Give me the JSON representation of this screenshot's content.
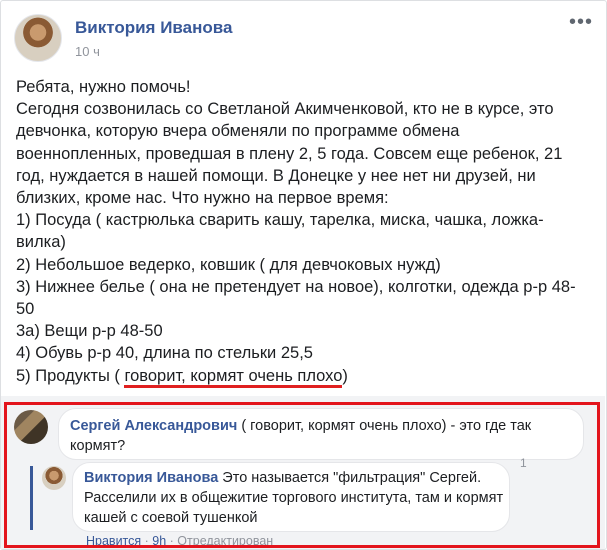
{
  "post": {
    "author": "Виктория Иванова",
    "time": "10 ч",
    "more_icon": "•••",
    "lines": [
      "Ребята, нужно помочь!",
      "Сегодня созвонилась со Светланой Акимченковой, кто не в курсе, это",
      "девчонка, которую вчера обменяли по программе обмена",
      "военнопленных, проведшая в плену 2, 5 года. Совсем еще ребенок, 21",
      "год, нуждается в нашей помощи. В Донецке у нее нет ни друзей, ни",
      "близких, кроме нас. Что нужно на первое время:",
      "1) Посуда ( кастрюлька сварить кашу, тарелка, миска, чашка, ложка-",
      "вилка)",
      "2) Небольшое ведерко, ковшик ( для девчоковых нужд)",
      "3) Нижнее белье ( она не претендует на новое), колготки, одежда р-р 48-",
      "50",
      "3а) Вещи р-р 48-50",
      "4) Обувь р-р 40, длина по стельки 25,5"
    ],
    "last_line_prefix": "5) Продукты ( ",
    "last_line_underlined": "говорит, кормят очень плохо",
    "last_line_suffix": ")"
  },
  "comments": {
    "first": {
      "author": "Сергей Александрович",
      "text": " ( говорит, кормят очень плохо) - это где так кормят?"
    },
    "reply": {
      "author": "Виктория Иванова",
      "text": " Это называется \"фильтрация\" Сергей. Расселили их в общежитие торгового института, там и кормят кашей с соевой тушенкой",
      "reaction_count": "1",
      "like_label": "Нравится",
      "separator": " · ",
      "time": "9h",
      "edited_label": "Отредактирован"
    }
  },
  "colors": {
    "link": "#385898",
    "highlight": "#e3141c"
  }
}
